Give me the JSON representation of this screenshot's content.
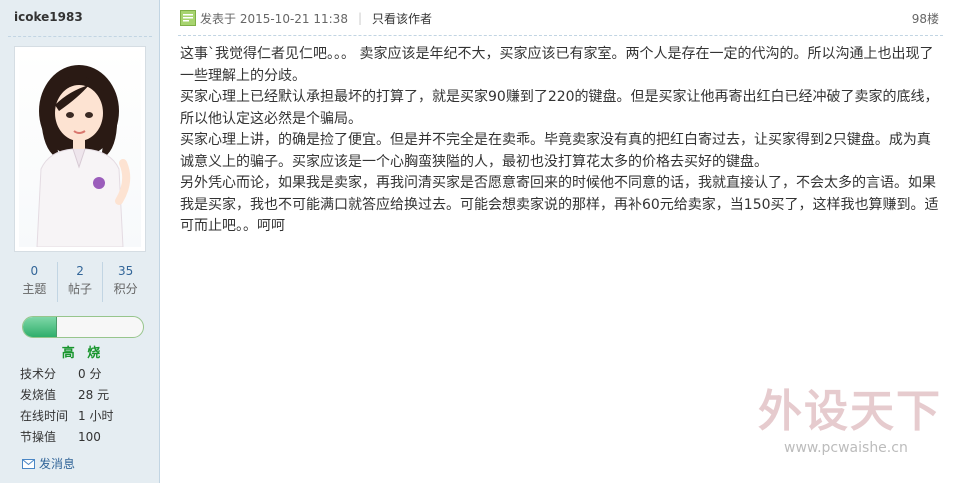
{
  "user": {
    "name": "icoke1983",
    "stats": [
      {
        "value": "0",
        "label": "主题"
      },
      {
        "value": "2",
        "label": "帖子"
      },
      {
        "value": "35",
        "label": "积分"
      }
    ],
    "level_progress": 0.28,
    "rank": "高 烧",
    "info": [
      {
        "key": "技术分",
        "value": "0 分"
      },
      {
        "key": "发烧值",
        "value": "28 元"
      },
      {
        "key": "在线时间",
        "value": "1 小时"
      },
      {
        "key": "节操值",
        "value": "100"
      }
    ],
    "pm_label": "发消息"
  },
  "post": {
    "posted_label": "发表于 2015-10-21 11:38",
    "author_only": "只看该作者",
    "floor": "98楼",
    "paragraphs": [
      "这事`我觉得仁者见仁吧。。。 卖家应该是年纪不大，买家应该已有家室。两个人是存在一定的代沟的。所以沟通上也出现了一些理解上的分歧。",
      "买家心理上已经默认承担最坏的打算了，就是买家90赚到了220的键盘。但是买家让他再寄出红白已经冲破了卖家的底线，所以他认定这必然是个骗局。",
      "买家心理上讲，的确是捡了便宜。但是并不完全是在卖乖。毕竟卖家没有真的把红白寄过去，让买家得到2只键盘。成为真诚意义上的骗子。买家应该是一个心胸蛮狭隘的人，最初也没打算花太多的价格去买好的键盘。",
      "另外凭心而论，如果我是卖家，再我问清买家是否愿意寄回来的时候他不同意的话，我就直接认了，不会太多的言语。如果我是买家，我也不可能满口就答应给换过去。可能会想卖家说的那样，再补60元给卖家，当150买了，这样我也算赚到。适可而止吧。。呵呵"
    ]
  },
  "watermark": {
    "title": "外设天下",
    "url": "www.pcwaishe.cn"
  },
  "colors": {
    "sidebar_bg": "#E5EDF2",
    "border": "#C2D5E3",
    "link": "#336699",
    "rank_green": "#19962e"
  }
}
